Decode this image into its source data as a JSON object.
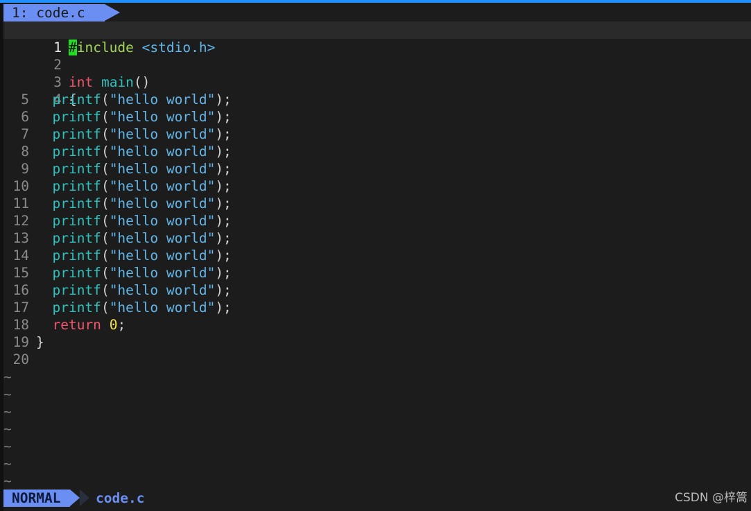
{
  "tab": {
    "label": "1: code.c"
  },
  "lines": [
    {
      "num": "1"
    },
    {
      "num": "2"
    },
    {
      "num": "3"
    },
    {
      "num": "4"
    },
    {
      "num": "5"
    },
    {
      "num": "6"
    },
    {
      "num": "7"
    },
    {
      "num": "8"
    },
    {
      "num": "9"
    },
    {
      "num": "10"
    },
    {
      "num": "11"
    },
    {
      "num": "12"
    },
    {
      "num": "13"
    },
    {
      "num": "14"
    },
    {
      "num": "15"
    },
    {
      "num": "16"
    },
    {
      "num": "17"
    },
    {
      "num": "18"
    },
    {
      "num": "19"
    },
    {
      "num": "20"
    }
  ],
  "code": {
    "cursor_char": "#",
    "include_kw": "include",
    "include_hdr": "<stdio.h>",
    "int_kw": "int",
    "main_fn": "main",
    "main_parens": "()",
    "open_brace": "{",
    "printf_fn": "printf",
    "open_paren": "(",
    "hello_str": "\"hello world\"",
    "close_stmt": ");",
    "return_kw": "return",
    "zero": "0",
    "semicolon": ";",
    "close_brace": "}"
  },
  "empty_line_marker": "~",
  "status": {
    "mode": "NORMAL",
    "filename": "code.c"
  },
  "watermark": "CSDN @梓篙",
  "colors": {
    "background": "#1c1c1c",
    "accent": "#6b8ef2",
    "cursor": "#22dd22",
    "keyword": "#f2556b",
    "function": "#2cc1bd",
    "string": "#62b6e8",
    "number": "#f5e14a",
    "preprocessor": "#a4d65e"
  }
}
